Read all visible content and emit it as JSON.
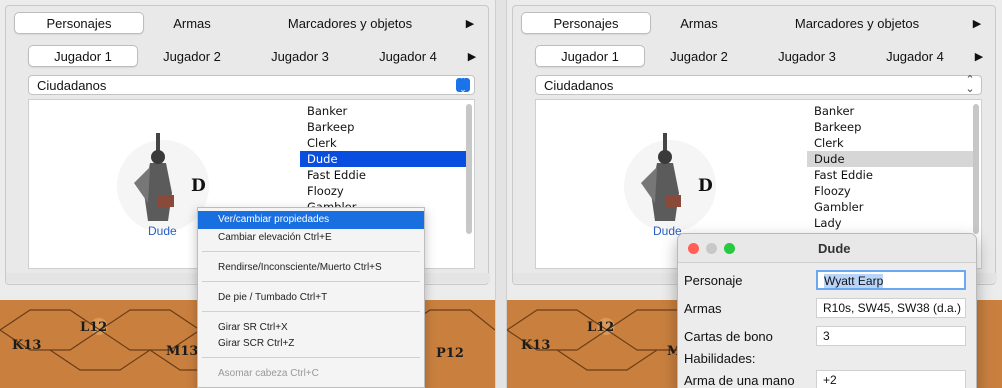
{
  "left": {
    "top_tabs": [
      "Personajes",
      "Armas",
      "Marcadores y objetos"
    ],
    "player_tabs": [
      "Jugador 1",
      "Jugador 2",
      "Jugador 3",
      "Jugador 4"
    ],
    "dropdown_value": "Ciudadanos",
    "characters": [
      "Banker",
      "Barkeep",
      "Clerk",
      "Dude",
      "Fast Eddie",
      "Floozy",
      "Gambler"
    ],
    "selected_character": "Dude",
    "unit_letter": "D",
    "unit_name": "Dude",
    "map_labels": [
      "K13",
      "L12",
      "M13",
      "P12"
    ],
    "context_menu": [
      "Ver/cambiar propiedades",
      "Cambiar elevación  Ctrl+E",
      "Rendirse/Inconsciente/Muerto  Ctrl+S",
      "De pie / Tumbado  Ctrl+T",
      "Girar SR  Ctrl+X",
      "Girar SCR  Ctrl+Z",
      "Asomar cabeza  Ctrl+C"
    ]
  },
  "right": {
    "top_tabs": [
      "Personajes",
      "Armas",
      "Marcadores y objetos"
    ],
    "player_tabs": [
      "Jugador 1",
      "Jugador 2",
      "Jugador 3",
      "Jugador 4"
    ],
    "dropdown_value": "Ciudadanos",
    "characters": [
      "Banker",
      "Barkeep",
      "Clerk",
      "Dude",
      "Fast Eddie",
      "Floozy",
      "Gambler",
      "Lady"
    ],
    "selected_character": "Dude",
    "unit_letter": "D",
    "unit_name": "Dude",
    "map_labels": [
      "K13",
      "L12",
      "M"
    ],
    "dialog": {
      "title": "Dude",
      "rows": [
        {
          "label": "Personaje",
          "value": "Wyatt Earp"
        },
        {
          "label": "Armas",
          "value": "R10s, SW45, SW38 (d.a.)"
        },
        {
          "label": "Cartas de bono",
          "value": "3"
        },
        {
          "label": "Habilidades:",
          "value": ""
        },
        {
          "label": "Arma de una mano",
          "value": "+2"
        }
      ]
    }
  },
  "colors": {
    "accent": "#1a6fe0",
    "selection_blue": "#0a4ee0",
    "map": "#c9803f"
  }
}
